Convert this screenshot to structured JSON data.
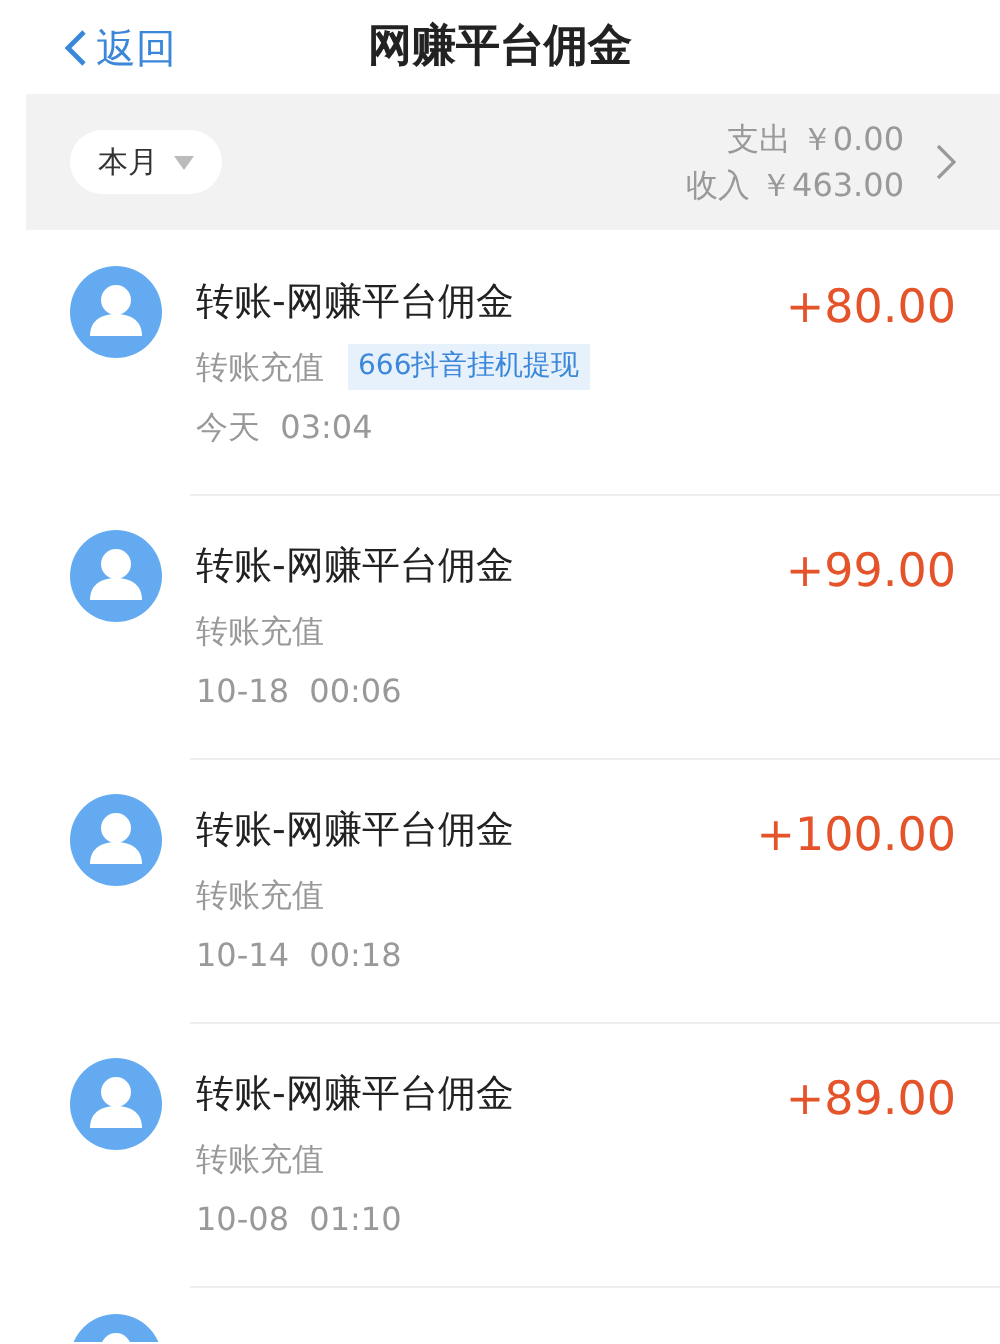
{
  "nav": {
    "back": "返回",
    "title": "网赚平台佣金"
  },
  "summary": {
    "period": "本月",
    "expense": "支出 ￥0.00",
    "income": "收入 ￥463.00"
  },
  "records": [
    {
      "title": "转账-网赚平台佣金",
      "type": "转账充值",
      "tag": "666抖音挂机提现",
      "time": "今天  03:04",
      "amount": "+80.00"
    },
    {
      "title": "转账-网赚平台佣金",
      "type": "转账充值",
      "time": "10-18  00:06",
      "amount": "+99.00"
    },
    {
      "title": "转账-网赚平台佣金",
      "type": "转账充值",
      "time": "10-14  00:18",
      "amount": "+100.00"
    },
    {
      "title": "转账-网赚平台佣金",
      "type": "转账充值",
      "time": "10-08  01:10",
      "amount": "+89.00"
    }
  ],
  "more_below": true
}
